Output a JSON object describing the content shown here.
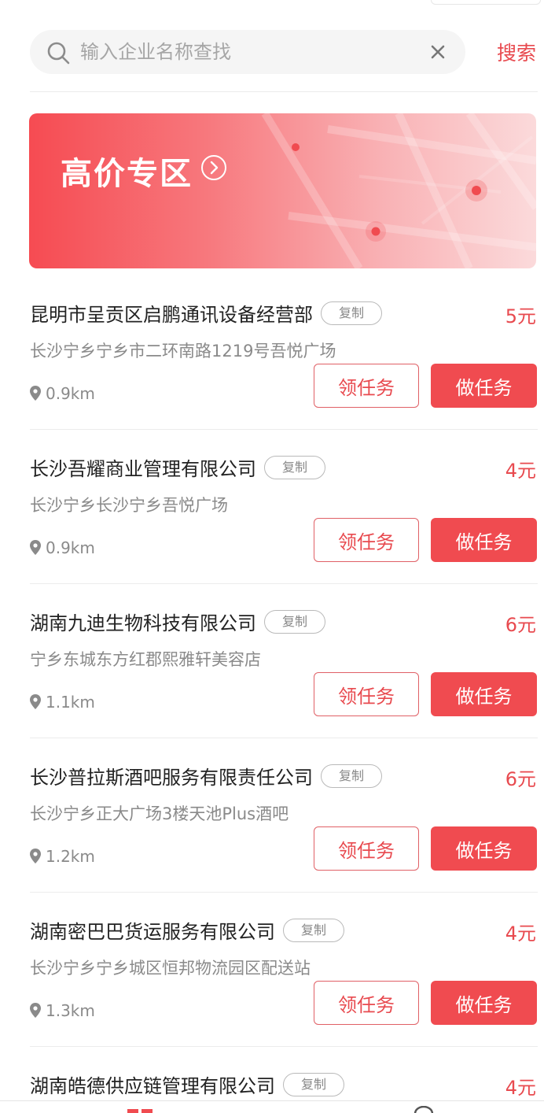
{
  "search": {
    "placeholder": "输入企业名称查找",
    "button_label": "搜索"
  },
  "banner": {
    "title": "高价专区"
  },
  "copy_label": "复制",
  "actions": {
    "take_label": "领任务",
    "do_label": "做任务"
  },
  "items": [
    {
      "name": "昆明市呈贡区启鹏通讯设备经营部",
      "price": "5元",
      "address": "长沙宁乡宁乡市二环南路1219号吾悦广场",
      "distance": "0.9km"
    },
    {
      "name": "长沙吾耀商业管理有限公司",
      "price": "4元",
      "address": "长沙宁乡长沙宁乡吾悦广场",
      "distance": "0.9km"
    },
    {
      "name": "湖南九迪生物科技有限公司",
      "price": "6元",
      "address": "宁乡东城东方红郡熙雅轩美容店",
      "distance": "1.1km"
    },
    {
      "name": "长沙普拉斯酒吧服务有限责任公司",
      "price": "6元",
      "address": "长沙宁乡正大广场3楼天池Plus酒吧",
      "distance": "1.2km"
    },
    {
      "name": "湖南密巴巴货运服务有限公司",
      "price": "4元",
      "address": "长沙宁乡宁乡城区恒邦物流园区配送站",
      "distance": "1.3km"
    },
    {
      "name": "湖南皓德供应链管理有限公司",
      "price": "4元",
      "address": "",
      "distance": ""
    }
  ],
  "colors": {
    "accent": "#f04b50",
    "price": "#e84a4f",
    "secondary_text": "#8a8a8a"
  }
}
